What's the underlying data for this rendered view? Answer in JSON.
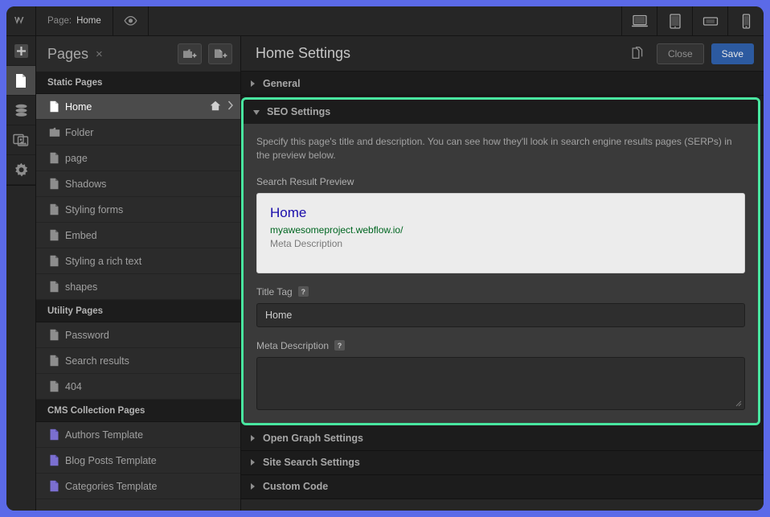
{
  "topbar": {
    "logo": "W",
    "crumb_label": "Page:",
    "crumb_value": "Home",
    "eye_icon": "eye-icon",
    "devices": [
      {
        "name": "desktop",
        "icon": "desktop-icon"
      },
      {
        "name": "tablet",
        "icon": "tablet-icon"
      },
      {
        "name": "tablet-landscape",
        "icon": "tablet-landscape-icon"
      },
      {
        "name": "mobile",
        "icon": "mobile-icon"
      }
    ]
  },
  "rail": {
    "items": [
      {
        "name": "add-panel",
        "icon": "plus-icon",
        "active": false
      },
      {
        "name": "pages-panel",
        "icon": "page-icon",
        "active": true
      },
      {
        "name": "cms-panel",
        "icon": "database-icon",
        "active": false
      },
      {
        "name": "assets-panel",
        "icon": "images-icon",
        "active": false
      },
      {
        "name": "settings-panel",
        "icon": "gear-icon",
        "active": false
      }
    ]
  },
  "pages": {
    "title": "Pages",
    "close_label": "×",
    "new_folder_label": "new-folder-icon",
    "new_page_label": "new-page-icon",
    "groups": [
      {
        "heading": "Static Pages",
        "items": [
          {
            "label": "Home",
            "icon": "page-icon",
            "selected": true,
            "home": true,
            "chevron": true
          },
          {
            "label": "Folder",
            "icon": "folder-icon",
            "selected": false
          },
          {
            "label": "page",
            "icon": "page-icon",
            "selected": false
          },
          {
            "label": "Shadows",
            "icon": "page-icon",
            "selected": false
          },
          {
            "label": "Styling forms",
            "icon": "page-icon",
            "selected": false
          },
          {
            "label": "Embed",
            "icon": "page-icon",
            "selected": false
          },
          {
            "label": "Styling a rich text",
            "icon": "page-icon",
            "selected": false
          },
          {
            "label": "shapes",
            "icon": "page-icon",
            "selected": false
          }
        ]
      },
      {
        "heading": "Utility Pages",
        "items": [
          {
            "label": "Password",
            "icon": "page-icon",
            "selected": false
          },
          {
            "label": "Search results",
            "icon": "page-icon",
            "selected": false
          },
          {
            "label": "404",
            "icon": "page-icon",
            "selected": false
          }
        ]
      },
      {
        "heading": "CMS Collection Pages",
        "items": [
          {
            "label": "Authors Template",
            "icon": "cms-page-icon",
            "selected": false
          },
          {
            "label": "Blog Posts Template",
            "icon": "cms-page-icon",
            "selected": false
          },
          {
            "label": "Categories Template",
            "icon": "cms-page-icon",
            "selected": false
          }
        ]
      }
    ]
  },
  "settings": {
    "title": "Home Settings",
    "copy_icon": "duplicate-icon",
    "close_label": "Close",
    "save_label": "Save",
    "section_general": "General",
    "section_seo": "SEO Settings",
    "section_open_graph": "Open Graph Settings",
    "section_site_search": "Site Search Settings",
    "section_custom_code": "Custom Code",
    "seo": {
      "help": "Specify this page's title and description. You can see how they'll look in search engine results pages (SERPs) in the preview below.",
      "preview_label": "Search Result Preview",
      "preview_title": "Home",
      "preview_url": "myawesomeproject.webflow.io/",
      "preview_desc": "Meta Description",
      "title_tag_label": "Title Tag",
      "title_tag_help": "?",
      "title_tag_value": "Home",
      "title_tag_placeholder": "",
      "meta_desc_label": "Meta Description",
      "meta_desc_help": "?",
      "meta_desc_value": "",
      "meta_desc_placeholder": ""
    }
  },
  "colors": {
    "highlight": "#49e6a0",
    "save_button": "#2c5aa0",
    "serp_title": "#1a0dab",
    "serp_url": "#006621",
    "page_backdrop": "#5b6ae8"
  }
}
